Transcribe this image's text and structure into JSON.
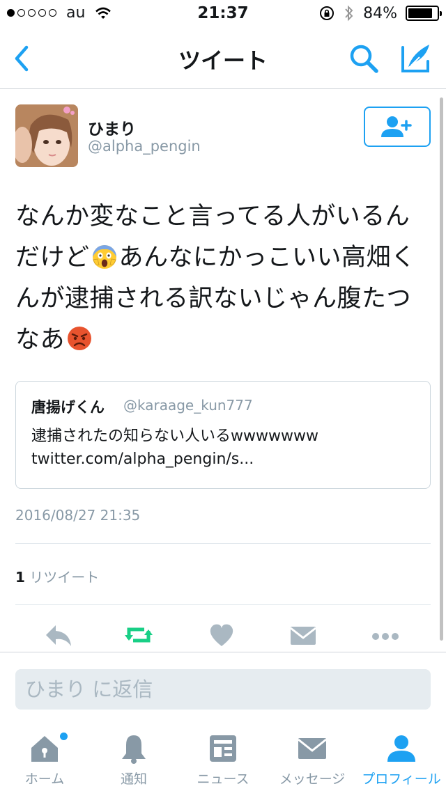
{
  "status_bar": {
    "carrier": "au",
    "time": "21:37",
    "battery": "84%",
    "battery_level": 0.84,
    "signal_bars_filled": 1,
    "signal_bars_total": 5
  },
  "nav": {
    "title": "ツイート",
    "icons": [
      "back-chevron-icon",
      "search-icon",
      "compose-icon"
    ]
  },
  "tweet": {
    "author_name": "ひまり",
    "author_handle": "@alpha_pengin",
    "text_part1": "なんか変なこと言ってる人がいるんだけど",
    "text_part2": "あんなにかっこいい高畑くんが逮捕される訳ないじゃん腹たつなあ",
    "emoji1": "face-screaming-in-fear",
    "emoji2": "angry-face",
    "timestamp": "2016/08/27 21:35",
    "retweet_count": "1",
    "retweet_label": " リツイート"
  },
  "quote": {
    "name": "唐揚げくん",
    "handle": "@karaage_kun777",
    "text_line1": "逮捕されたの知らない人いるwwwwwww",
    "text_line2": "twitter.com/alpha_pengin/s..."
  },
  "actions": [
    "reply-icon",
    "retweet-icon",
    "like-icon",
    "direct-message-icon",
    "more-icon"
  ],
  "colors": {
    "accent": "#1da1f2",
    "retweet_green": "#19cf86",
    "icon_gray": "#aab8c2",
    "tab_gray": "#8899a6"
  },
  "reply": {
    "placeholder": "ひまり に返信"
  },
  "tabs": [
    {
      "label": "ホーム",
      "icon": "home-icon"
    },
    {
      "label": "通知",
      "icon": "bell-icon"
    },
    {
      "label": "ニュース",
      "icon": "news-icon"
    },
    {
      "label": "メッセージ",
      "icon": "envelope-icon"
    },
    {
      "label": "プロフィール",
      "icon": "person-icon",
      "active": true
    }
  ]
}
